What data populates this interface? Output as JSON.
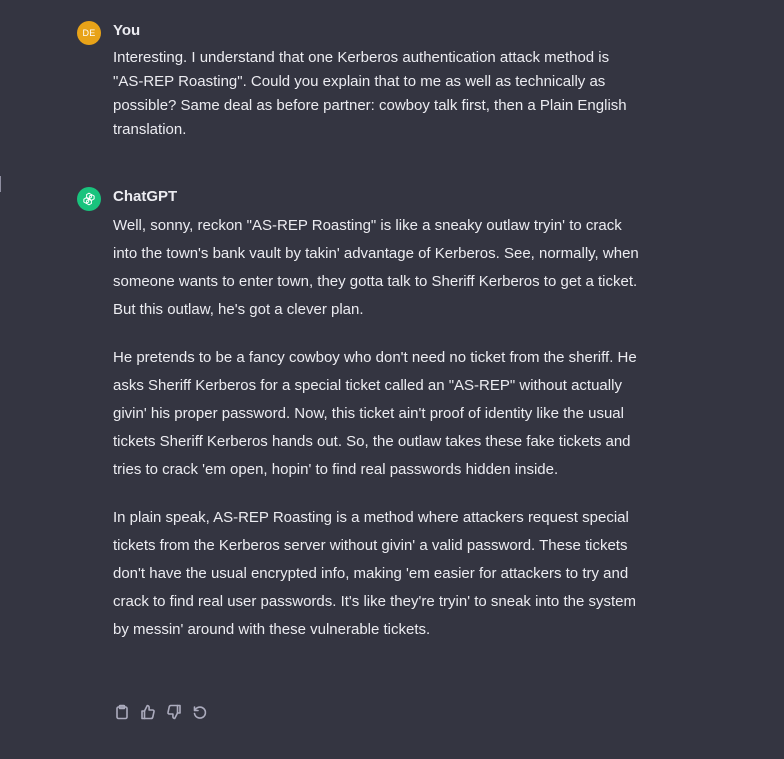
{
  "user_message": {
    "avatar_initials": "DE",
    "author": "You",
    "text": "Interesting. I understand that one Kerberos authentication attack method is \"AS-REP Roasting\". Could you explain that to me as well as technically as possible? Same deal as before partner: cowboy talk first, then a Plain English translation."
  },
  "assistant_message": {
    "author": "ChatGPT",
    "paragraphs": [
      "Well, sonny, reckon \"AS-REP Roasting\" is like a sneaky outlaw tryin' to crack into the town's bank vault by takin' advantage of Kerberos. See, normally, when someone wants to enter town, they gotta talk to Sheriff Kerberos to get a ticket. But this outlaw, he's got a clever plan.",
      "He pretends to be a fancy cowboy who don't need no ticket from the sheriff. He asks Sheriff Kerberos for a special ticket called an \"AS-REP\" without actually givin' his proper password. Now, this ticket ain't proof of identity like the usual tickets Sheriff Kerberos hands out. So, the outlaw takes these fake tickets and tries to crack 'em open, hopin' to find real passwords hidden inside.",
      "In plain speak, AS-REP Roasting is a method where attackers request special tickets from the Kerberos server without givin' a valid password. These tickets don't have the usual encrypted info, making 'em easier for attackers to try and crack to find real user passwords. It's like they're tryin' to sneak into the system by messin' around with these vulnerable tickets."
    ]
  },
  "actions": [
    {
      "icon": "clipboard-icon"
    },
    {
      "icon": "thumbs-up-icon"
    },
    {
      "icon": "thumbs-down-icon"
    },
    {
      "icon": "regenerate-icon"
    }
  ],
  "colors": {
    "background": "#343541",
    "text": "#ececf1",
    "user_avatar": "#e8a318",
    "assistant_avatar": "#19c37d",
    "icon": "#acacbe"
  }
}
